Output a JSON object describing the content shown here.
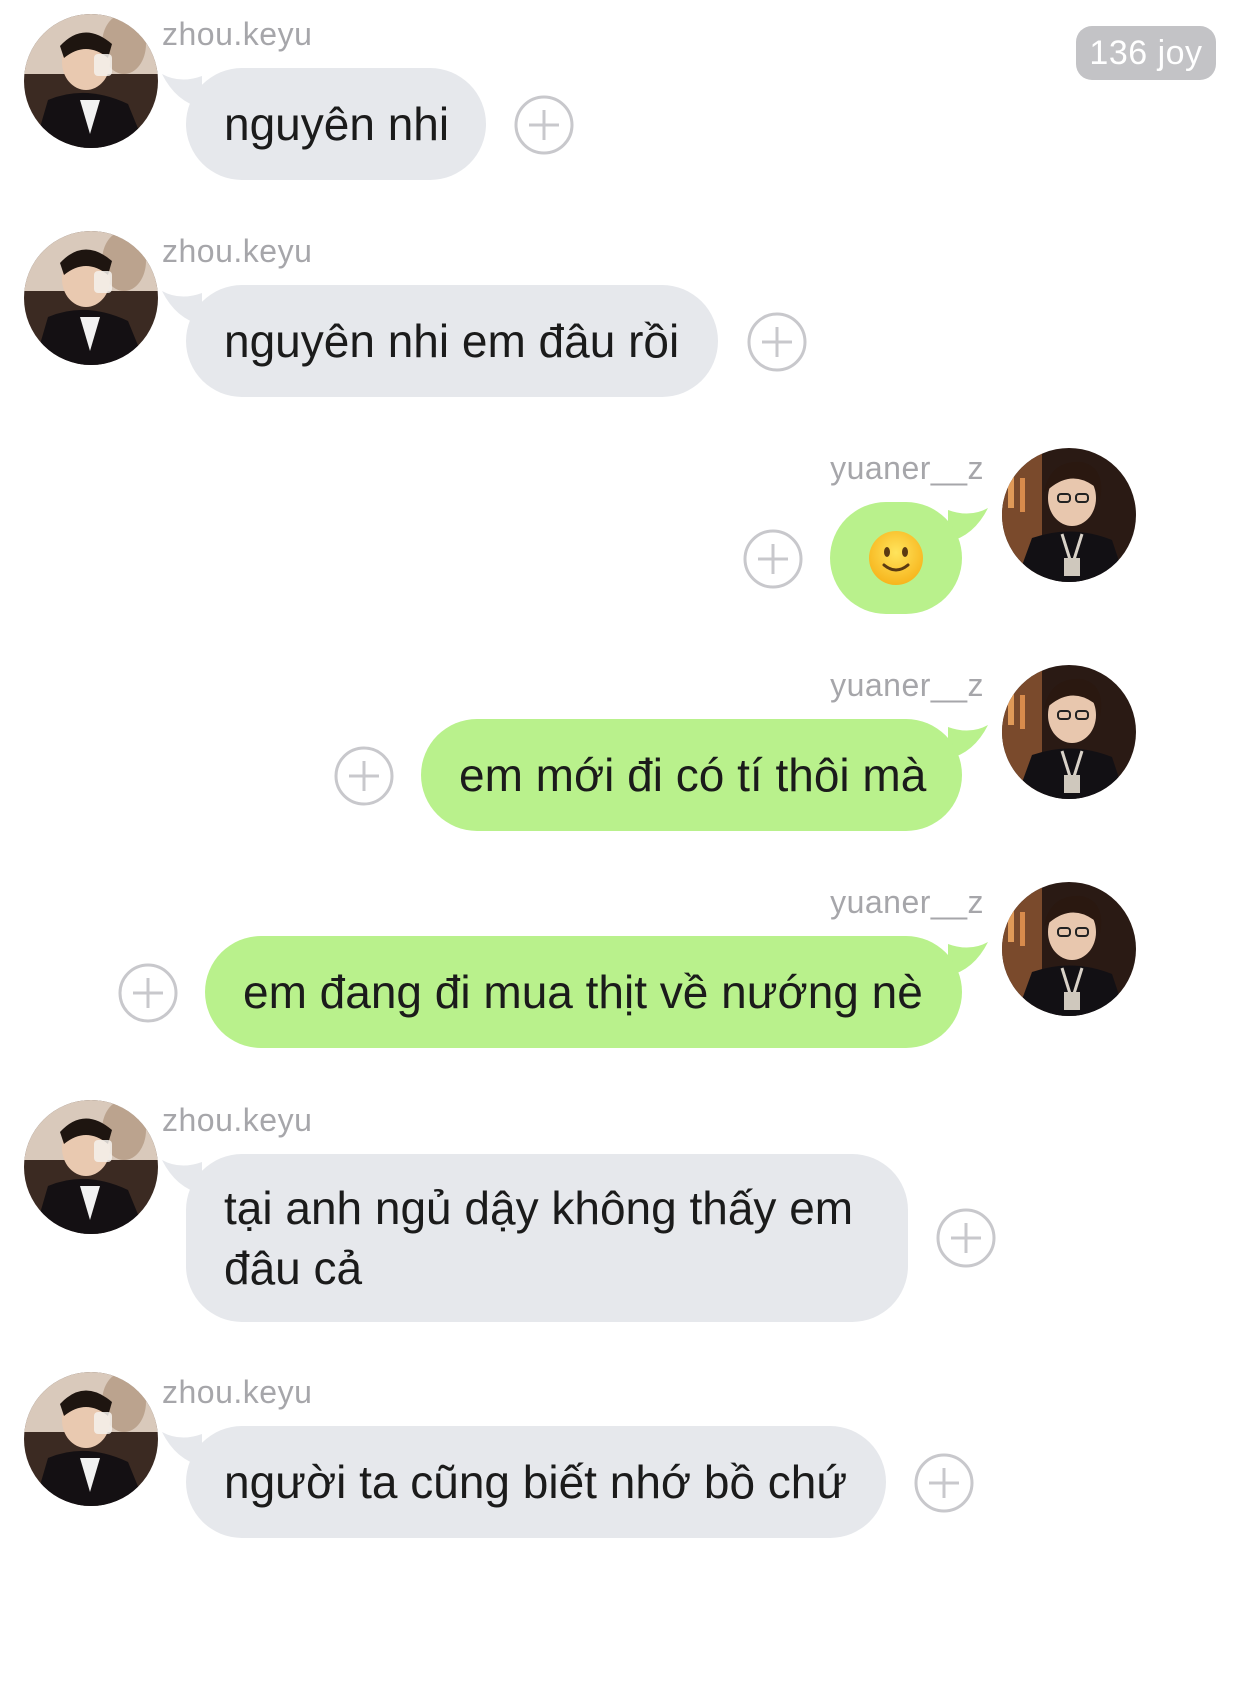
{
  "badge": {
    "text": "136 joy"
  },
  "messages": [
    {
      "sender": "zhou.keyu",
      "text": "nguyên nhi"
    },
    {
      "sender": "zhou.keyu",
      "text": "nguyên nhi em đâu rồi"
    },
    {
      "sender": "yuaner__z",
      "emoji": "slightly-smiling-face"
    },
    {
      "sender": "yuaner__z",
      "text": "em mới đi có tí thôi mà"
    },
    {
      "sender": "yuaner__z",
      "text": "em đang đi mua thịt về nướng nè"
    },
    {
      "sender": "zhou.keyu",
      "text": "tại anh ngủ dậy không thấy em đâu cả"
    },
    {
      "sender": "zhou.keyu",
      "text": "người ta cũng biết nhớ bồ chứ"
    }
  ],
  "colors": {
    "incoming_bubble": "#e6e8ec",
    "outgoing_bubble": "#b9f18c",
    "username": "#a6a6aa",
    "badge": "#c3c3c6",
    "plus_icon": "#c8c8cc"
  },
  "icons": {
    "add_reaction": "plus-circle-icon",
    "avatar_left": "profile-photo",
    "avatar_right": "profile-photo"
  }
}
